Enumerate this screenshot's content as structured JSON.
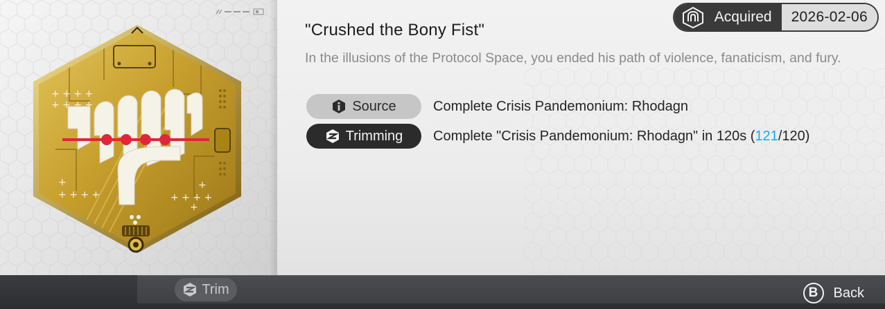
{
  "medal": {
    "name": "Crushed the Bony Fist",
    "title_display": "\"Crushed the Bony Fist\"",
    "description": "In the illusions of the Protocol Space, you ended his path of violence, fanaticism, and fury.",
    "colors": {
      "gold": "#c9a235",
      "gold_dark": "#8c6a12",
      "accent_red": "#e0263a",
      "white": "#f4f1e6"
    }
  },
  "status": {
    "label": "Acquired",
    "date": "2026-02-06",
    "icon": "medal-rank-icon"
  },
  "requirements": {
    "source": {
      "label": "Source",
      "icon": "info-icon",
      "text": "Complete Crisis Pandemonium: Rhodagn"
    },
    "trimming": {
      "label": "Trimming",
      "icon": "trim-icon",
      "text_prefix": "Complete \"Crisis Pandemonium: Rhodagn\" in 120s (",
      "progress_current": "121",
      "text_suffix": "/120)",
      "highlight_color": "#1fa6f2"
    }
  },
  "bottom_bar": {
    "trim_button_label": "Trim",
    "back_key": "B",
    "back_label": "Back"
  }
}
